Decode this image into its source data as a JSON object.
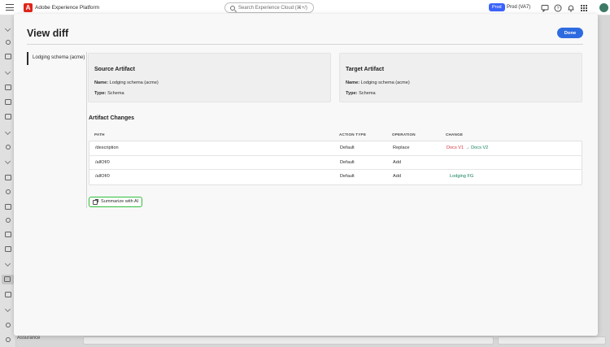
{
  "app": {
    "brand_name": "Adobe Experience Platform",
    "search_placeholder": "Search Experience Cloud (⌘+/)",
    "environment_badge": "Prod",
    "sandbox_name": "Prod (VA7)",
    "rail_footer_label": "Assurance"
  },
  "modal": {
    "title": "View diff",
    "done_label": "Done",
    "side_nav": {
      "selected_item": "Lodging schema (acme)"
    },
    "source_card": {
      "title": "Source Artifact",
      "name_label": "Name:",
      "name_value": "Lodging schema (acme)",
      "type_label": "Type:",
      "type_value": "Schema"
    },
    "target_card": {
      "title": "Target Artifact",
      "name_label": "Name:",
      "name_value": "Lodging schema (acme)",
      "type_label": "Type:",
      "type_value": "Schema"
    },
    "changes": {
      "title": "Artifact Changes",
      "columns": [
        "PATH",
        "ACTION TYPE",
        "OPERATION",
        "CHANGE"
      ],
      "rows": [
        {
          "path": "/description",
          "action_type": "Default",
          "operation": "Replace",
          "change_old": "Docs V1",
          "change_arrow": "→",
          "change_new": "Docs V2"
        },
        {
          "path": "/allOf/0",
          "action_type": "Default",
          "operation": "Add",
          "change_old": "",
          "change_arrow": "",
          "change_new": ""
        },
        {
          "path": "/allOf/0",
          "action_type": "Default",
          "operation": "Add",
          "change_old": "",
          "change_arrow": "",
          "change_new": "Lodging FG"
        }
      ]
    },
    "summarize_label": "Summarize with AI"
  },
  "colors": {
    "accent": "#2e6be0",
    "change_removed": "#d7373f",
    "change_added": "#12805c",
    "highlight_outline": "#2fbf3a"
  }
}
